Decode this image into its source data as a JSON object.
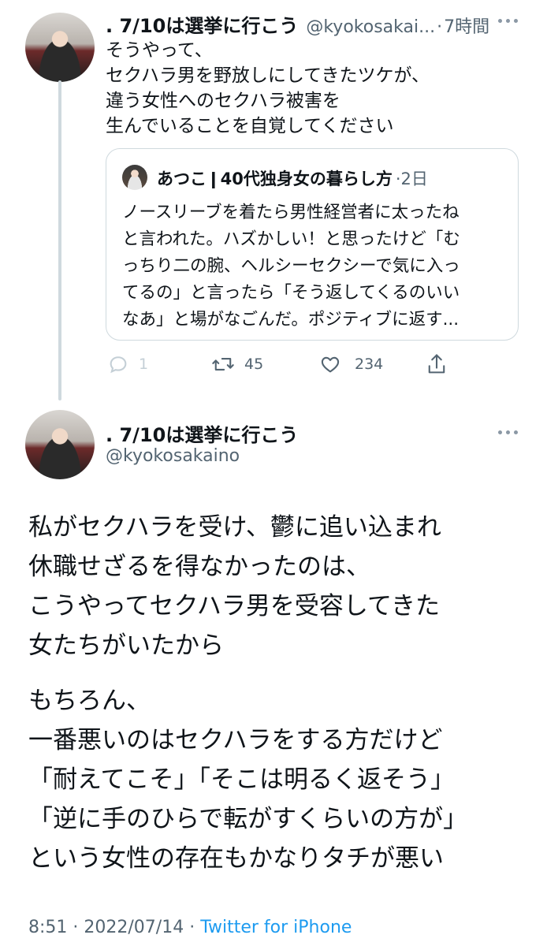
{
  "tweet1": {
    "display_name": ". 7/10は選挙に行こう",
    "handle": "@kyokosakai...",
    "separator": "·",
    "time": "7時間",
    "lines": [
      "そうやって、",
      "セクハラ男を野放しにしてきたツケが、",
      "違う女性へのセクハラ被害を",
      "生んでいることを自覚してください"
    ],
    "quote": {
      "display_name": "あつこ❙40代独身女の暮らし方",
      "time": "·2日",
      "lines": [
        "ノースリーブを着たら男性経営者に太ったね",
        "と言われた。ハズかしい！と思ったけど「む",
        "っちり二の腕、ヘルシーセクシーで気に入っ",
        "てるの」と言ったら「そう返してくるのいい",
        "なあ」と場がなごんだ。ポジティブに返す..."
      ]
    },
    "actions": {
      "reply_count": "1",
      "retweet_count": "45",
      "like_count": "234"
    }
  },
  "tweet2": {
    "display_name": ". 7/10は選挙に行こう",
    "handle": "@kyokosakaino",
    "paragraph1": [
      "私がセクハラを受け、鬱に追い込まれ",
      "休職せざるを得なかったのは、",
      "こうやってセクハラ男を受容してきた",
      "女たちがいたから"
    ],
    "paragraph2": [
      "もちろん、",
      "一番悪いのはセクハラをする方だけど",
      "「耐えてこそ」「そこは明るく返そう」",
      "「逆に手のひらで転がすくらいの方が」",
      "という女性の存在もかなりタチが悪い"
    ],
    "footer": {
      "time": "8:51",
      "separator": " · ",
      "date": "2022/07/14",
      "separator2": " · ",
      "source": "Twitter for iPhone"
    }
  },
  "colors": {
    "text": "#0f1419",
    "muted": "#536471",
    "link": "#1d9bf0",
    "border": "#cfd9de"
  },
  "icons": [
    "more-icon",
    "reply-icon",
    "retweet-icon",
    "like-icon",
    "share-icon"
  ]
}
